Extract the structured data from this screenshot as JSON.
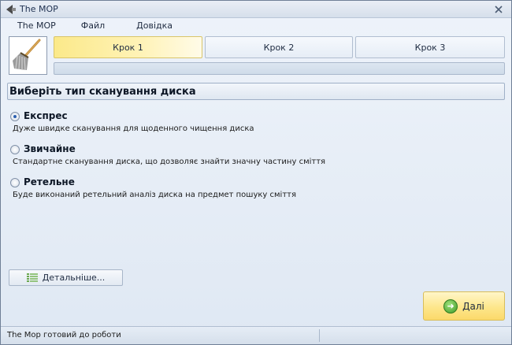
{
  "window": {
    "title": "The MOP",
    "icon": "broom-arrow-icon"
  },
  "menu": {
    "items": [
      "The MOP",
      "Файл",
      "Довідка"
    ]
  },
  "steps": [
    {
      "label": "Крок 1",
      "active": true
    },
    {
      "label": "Крок 2",
      "active": false
    },
    {
      "label": "Крок 3",
      "active": false
    }
  ],
  "progress": 0,
  "section": {
    "title": "Виберіть тип сканування диска"
  },
  "options": [
    {
      "label": "Експрес",
      "description": "Дуже швидке сканування для щоденного чищення диска",
      "checked": true
    },
    {
      "label": "Звичайне",
      "description": "Стандартне сканування диска, що дозволяє знайти значну частину сміття",
      "checked": false
    },
    {
      "label": "Ретельне",
      "description": "Буде виконаний ретельний аналіз диска на предмет пошуку сміття",
      "checked": false
    }
  ],
  "buttons": {
    "details_label": "Детальніше...",
    "next_label": "Далі"
  },
  "status": {
    "text": "The Mop готовий до роботи"
  },
  "colors": {
    "active_step": "#fbe98a",
    "next_button": "#fde68b",
    "section_border": "#9fb0c7"
  }
}
